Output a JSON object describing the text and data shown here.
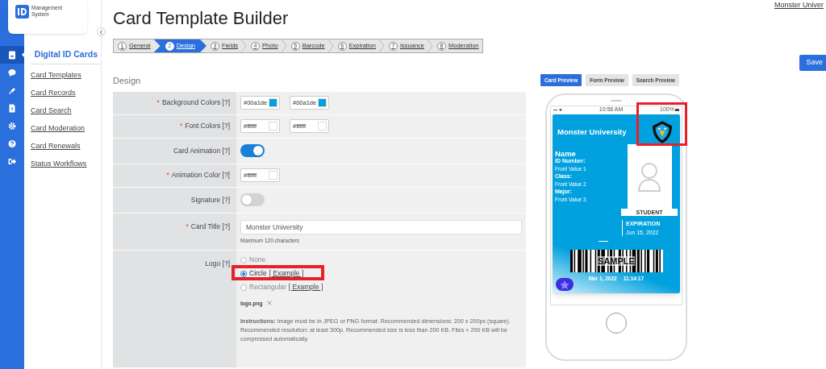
{
  "brand": {
    "line_1": "Management",
    "line_2": "System"
  },
  "rail_items": [
    {
      "selected": true
    },
    {
      "selected": false
    },
    {
      "selected": false
    },
    {
      "selected": false
    },
    {
      "selected": false
    },
    {
      "selected": false
    },
    {
      "selected": false
    }
  ],
  "sidebar": {
    "heading": "Digital ID Cards",
    "items": [
      "Card Templates",
      "Card Records",
      "Card Search",
      "Card Moderation",
      "Card Renewals",
      "Status Workflows"
    ]
  },
  "page_title": "Card Template Builder",
  "user_link": "Monster Univer",
  "save_button": "Save",
  "steps": [
    {
      "number": "1",
      "label": "General",
      "selected": false
    },
    {
      "number": "2",
      "label": "Design",
      "selected": true
    },
    {
      "number": "3",
      "label": "Fields",
      "selected": false
    },
    {
      "number": "4",
      "label": "Photo",
      "selected": false
    },
    {
      "number": "5",
      "label": "Barcode",
      "selected": false
    },
    {
      "number": "6",
      "label": "Expiration",
      "selected": false
    },
    {
      "number": "7",
      "label": "Issuance",
      "selected": false
    },
    {
      "number": "8",
      "label": "Moderation",
      "selected": false
    }
  ],
  "section_title": "Design",
  "form_rows": [
    {
      "kind": "colors",
      "label": "Background Colors [?]",
      "required_mark": "*",
      "swatches": [
        {
          "value": "#00a1de",
          "color": "#00a1de"
        },
        {
          "value": "#00a1de",
          "color": "#00a1de"
        }
      ]
    },
    {
      "kind": "colors",
      "label": "Font Colors [?]",
      "required_mark": "*",
      "swatches": [
        {
          "value": "#ffffff",
          "color": "#ffffff"
        },
        {
          "value": "#ffffff",
          "color": "#ffffff"
        }
      ]
    },
    {
      "kind": "toggle",
      "label": "Card Animation [?]",
      "on": true
    },
    {
      "kind": "colors",
      "label": "Animation Color [?]",
      "required_mark": "*",
      "swatches": [
        {
          "value": "#ffffff",
          "color": "#ffffff"
        }
      ]
    },
    {
      "kind": "toggle",
      "label": "Signature [?]",
      "on": false
    },
    {
      "kind": "text",
      "label": "Card Title [?]",
      "required_mark": "*",
      "value": "Monster University",
      "hint": "Maximum 120 characters"
    },
    {
      "kind": "logo",
      "label": "Logo [?]",
      "options": [
        {
          "label": "None",
          "selected": false
        },
        {
          "label": "Circle",
          "link": "[ Example ]",
          "selected": true
        },
        {
          "label": "Rectangular",
          "link": "[ Example ]",
          "selected": false
        }
      ],
      "file": "logo.png",
      "instructions": "**Instructions:** Image must be in JPEG or PNG format. Recommended dimensions: 200 x 200px (square). Recommended resolution: at least 300p. Recommended size is less than 200 KB. Files > 200 KB will be compressed automatically."
    }
  ],
  "preview_tabs": [
    {
      "label": "Card Preview",
      "selected": true
    },
    {
      "label": "Form Preview",
      "selected": false
    },
    {
      "label": "Search Preview",
      "selected": false
    }
  ],
  "phone": {
    "time": "10:58 AM",
    "battery": "100%"
  },
  "card": {
    "title": "Monster University",
    "name": "Name",
    "fields": [
      {
        "label": "ID Number:",
        "value": "Front Value 1"
      },
      {
        "label": "Class:",
        "value": "Front Value 2"
      },
      {
        "label": "Major:",
        "value": "Front Value 3"
      }
    ],
    "photo_label": "STUDENT",
    "expiration_label": "EXPIRATION",
    "expiration_date": "Jun 15, 2022",
    "barcode_text": "SAMPLE",
    "date": "Mar 1, 2022",
    "time": "11:14:17"
  }
}
